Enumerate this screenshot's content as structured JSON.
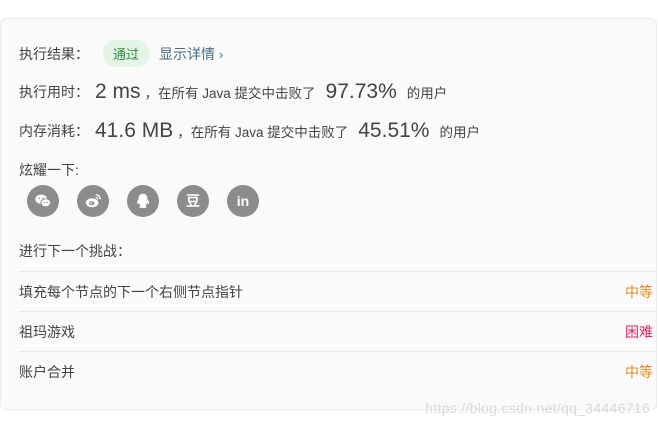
{
  "result": {
    "label": "执行结果：",
    "status": "通过",
    "details_link": "显示详情",
    "details_chevron": "›"
  },
  "runtime": {
    "label": "执行用时：",
    "value": "2 ms",
    "mid_text": "，在所有 Java 提交中击败了",
    "percent": "97.73%",
    "suffix": "的用户"
  },
  "memory": {
    "label": "内存消耗：",
    "value": "41.6 MB",
    "mid_text": "，在所有 Java 提交中击败了",
    "percent": "45.51%",
    "suffix": "的用户"
  },
  "share": {
    "label": "炫耀一下:",
    "icons": [
      "wechat-icon",
      "weibo-icon",
      "qq-icon",
      "douban-icon",
      "linkedin-icon"
    ],
    "douban_glyph": "豆",
    "linkedin_glyph": "in"
  },
  "challenge": {
    "title": "进行下一个挑战：",
    "items": [
      {
        "name": "填充每个节点的下一个右侧节点指针",
        "difficulty": "中等"
      },
      {
        "name": "祖玛游戏",
        "difficulty": "困难"
      },
      {
        "name": "账户合并",
        "difficulty": "中等"
      }
    ]
  },
  "colors": {
    "medium": "#e08a1e",
    "hard": "#e0245e",
    "pass_bg": "#e4f4e7",
    "pass_text": "#2e8b3e",
    "icon_bg": "#8c8c8c"
  },
  "watermark": "https://blog.csdn.net/qq_34446716"
}
